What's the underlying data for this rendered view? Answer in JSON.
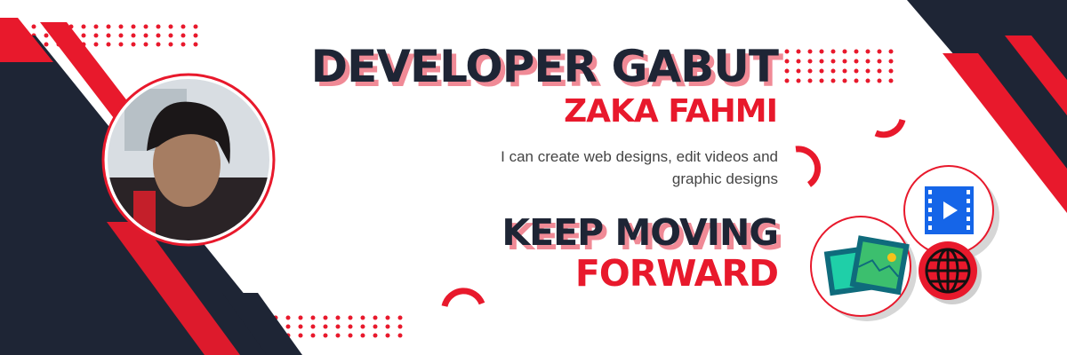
{
  "banner": {
    "title": "DEVELOPER GABUT",
    "name": "ZAKA FAHMI",
    "description_line1": "I can create web designs, edit videos and",
    "description_line2": "graphic designs",
    "motto_line1": "KEEP MOVING",
    "motto_line2": "FORWARD"
  },
  "colors": {
    "navy": "#1e2535",
    "red": "#e8192c",
    "pink_shadow": "#f08a96"
  },
  "icons": [
    "avatar-photo",
    "image-gallery-icon",
    "video-play-icon",
    "globe-icon"
  ]
}
